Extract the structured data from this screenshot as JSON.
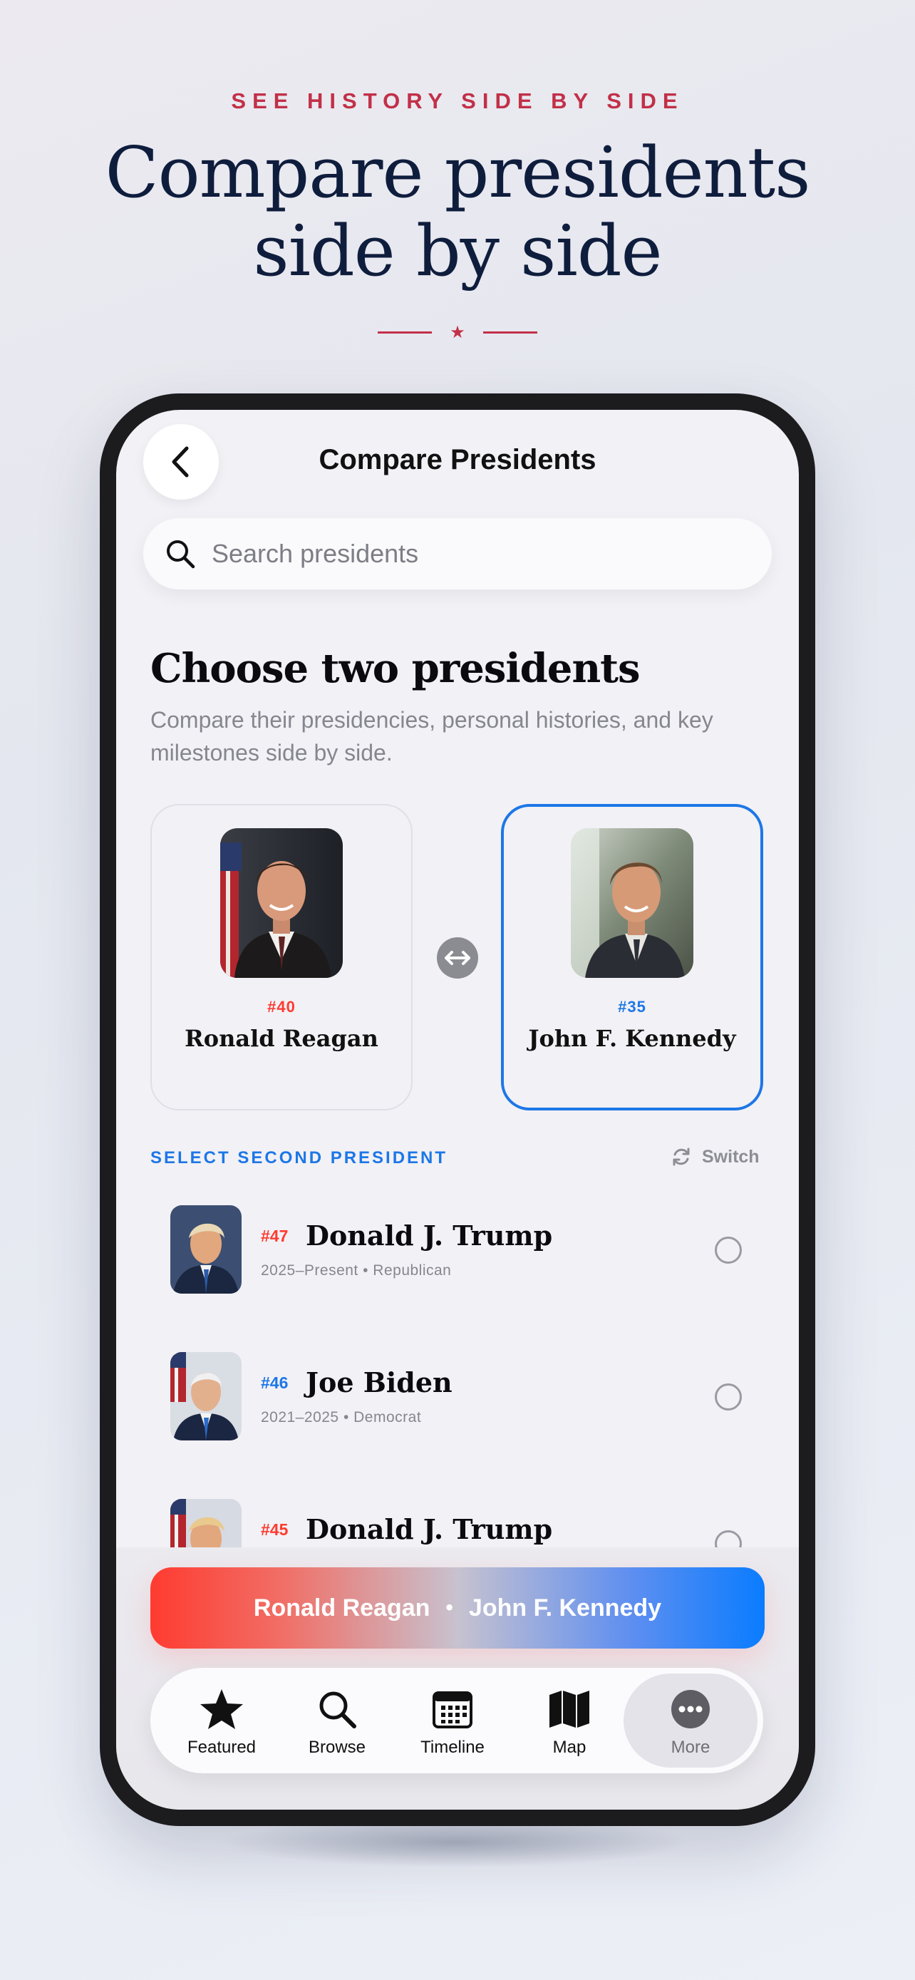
{
  "promo": {
    "kicker": "SEE HISTORY SIDE BY SIDE",
    "title_line1": "Compare presidents",
    "title_line2": "side by side",
    "divider_icon": "star-icon"
  },
  "colors": {
    "accent_red": "#c23048",
    "blue": "#1d77e6",
    "republican_red": "#ff3b30",
    "democrat_blue": "#0a7cff"
  },
  "nav": {
    "title": "Compare Presidents",
    "back_icon": "chevron-left-icon"
  },
  "search": {
    "placeholder": "Search presidents",
    "value": ""
  },
  "intro": {
    "heading": "Choose two presidents",
    "subtitle": "Compare their presidencies, personal histories, and key milestones side by side."
  },
  "selection": {
    "first": {
      "number": "#40",
      "name": "Ronald Reagan",
      "selected": false
    },
    "second": {
      "number": "#35",
      "name": "John F. Kennedy",
      "selected": true
    },
    "swap_icon": "swap-arrows-icon"
  },
  "list": {
    "label": "SELECT SECOND PRESIDENT",
    "switch_label": "Switch",
    "items": [
      {
        "number": "#47",
        "name": "Donald J. Trump",
        "meta": "2025–Present • Republican"
      },
      {
        "number": "#46",
        "name": "Joe Biden",
        "meta": "2021–2025 • Democrat"
      },
      {
        "number": "#45",
        "name": "Donald J. Trump",
        "meta": ""
      }
    ]
  },
  "compare_button": {
    "left": "Ronald Reagan",
    "separator": "•",
    "right": "John F. Kennedy"
  },
  "tabs": [
    {
      "label": "Featured",
      "icon": "star-icon"
    },
    {
      "label": "Browse",
      "icon": "search-icon"
    },
    {
      "label": "Timeline",
      "icon": "calendar-icon"
    },
    {
      "label": "Map",
      "icon": "map-icon"
    },
    {
      "label": "More",
      "icon": "more-icon",
      "active": true
    }
  ]
}
